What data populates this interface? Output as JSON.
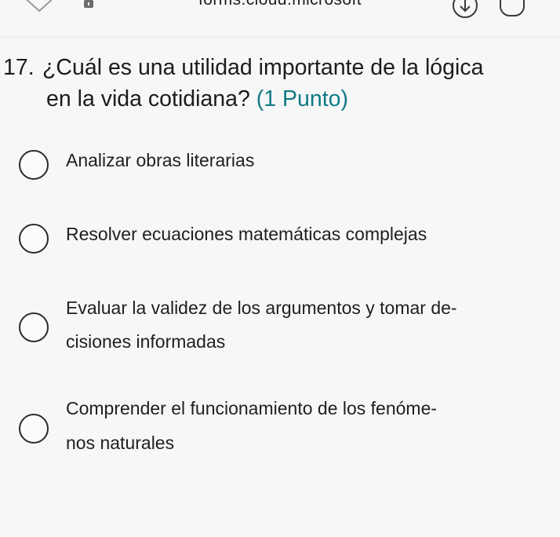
{
  "browser": {
    "url": "forms.cloud.microsoft",
    "icons": [
      "tab-shape-icon",
      "lock-icon",
      "download-icon",
      "tab-count-icon"
    ]
  },
  "question": {
    "number": "17.",
    "text_line1": "¿Cuál es una utilidad importante de la lógica",
    "text_line2": "en la vida cotidiana?",
    "points": "(1 Punto)"
  },
  "options": [
    {
      "lines": [
        "Analizar obras literarias"
      ]
    },
    {
      "lines": [
        "Resolver ecuaciones matemáticas complejas"
      ]
    },
    {
      "lines": [
        "Evaluar la validez de los argumentos y tomar de-",
        "cisiones informadas"
      ]
    },
    {
      "lines": [
        "Comprender el funcionamiento de los fenóme-",
        "nos naturales"
      ]
    }
  ],
  "colors": {
    "accent": "#0f7a84",
    "background": "#f6f7f7"
  }
}
